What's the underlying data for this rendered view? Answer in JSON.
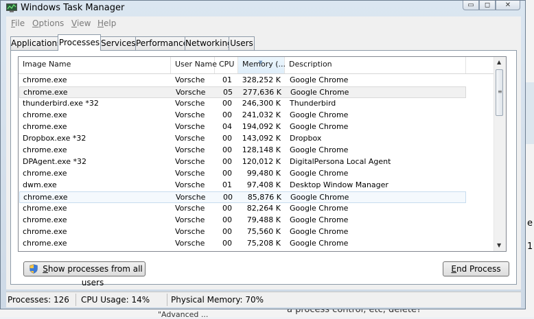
{
  "window": {
    "title": "Windows Task Manager"
  },
  "caption_buttons": {
    "min": "▭",
    "max": "◻",
    "close": "✕"
  },
  "menu": [
    {
      "key": "F",
      "rest": "ile"
    },
    {
      "key": "O",
      "rest": "ptions"
    },
    {
      "key": "V",
      "rest": "iew"
    },
    {
      "key": "H",
      "rest": "elp"
    }
  ],
  "tabs": [
    "Applications",
    "Processes",
    "Services",
    "Performance",
    "Networking",
    "Users"
  ],
  "active_tab": "Processes",
  "columns": {
    "name": "Image Name",
    "user": "User Name",
    "cpu": "CPU",
    "memory": "Memory (...",
    "description": "Description"
  },
  "processes": [
    {
      "name": "chrome.exe",
      "user": "Vorsche",
      "cpu": "01",
      "memory": "328,252 K",
      "description": "Google Chrome"
    },
    {
      "name": "chrome.exe",
      "user": "Vorsche",
      "cpu": "05",
      "memory": "277,636 K",
      "description": "Google Chrome"
    },
    {
      "name": "thunderbird.exe *32",
      "user": "Vorsche",
      "cpu": "00",
      "memory": "246,300 K",
      "description": "Thunderbird"
    },
    {
      "name": "chrome.exe",
      "user": "Vorsche",
      "cpu": "00",
      "memory": "241,032 K",
      "description": "Google Chrome"
    },
    {
      "name": "chrome.exe",
      "user": "Vorsche",
      "cpu": "04",
      "memory": "194,092 K",
      "description": "Google Chrome"
    },
    {
      "name": "Dropbox.exe *32",
      "user": "Vorsche",
      "cpu": "00",
      "memory": "143,092 K",
      "description": "Dropbox"
    },
    {
      "name": "chrome.exe",
      "user": "Vorsche",
      "cpu": "00",
      "memory": "128,148 K",
      "description": "Google Chrome"
    },
    {
      "name": "DPAgent.exe *32",
      "user": "Vorsche",
      "cpu": "00",
      "memory": "120,012 K",
      "description": "DigitalPersona Local Agent"
    },
    {
      "name": "chrome.exe",
      "user": "Vorsche",
      "cpu": "00",
      "memory": "99,480 K",
      "description": "Google Chrome"
    },
    {
      "name": "dwm.exe",
      "user": "Vorsche",
      "cpu": "01",
      "memory": "97,408 K",
      "description": "Desktop Window Manager"
    },
    {
      "name": "chrome.exe",
      "user": "Vorsche",
      "cpu": "00",
      "memory": "85,876 K",
      "description": "Google Chrome"
    },
    {
      "name": "chrome.exe",
      "user": "Vorsche",
      "cpu": "00",
      "memory": "82,264 K",
      "description": "Google Chrome"
    },
    {
      "name": "chrome.exe",
      "user": "Vorsche",
      "cpu": "00",
      "memory": "79,488 K",
      "description": "Google Chrome"
    },
    {
      "name": "chrome.exe",
      "user": "Vorsche",
      "cpu": "00",
      "memory": "75,560 K",
      "description": "Google Chrome"
    },
    {
      "name": "chrome.exe",
      "user": "Vorsche",
      "cpu": "00",
      "memory": "75,208 K",
      "description": "Google Chrome"
    }
  ],
  "buttons": {
    "show_all_key": "S",
    "show_all_rest": "how processes from all users",
    "end_key": "E",
    "end_rest": "nd Process"
  },
  "status": {
    "processes": "Processes: 126",
    "cpu_usage": "CPU Usage: 14%",
    "physical_memory": "Physical Memory: 70%"
  },
  "background": {
    "text_1": "e",
    "text_2": "1",
    "text_3": "\"Advanced ...",
    "text_4": "a process control, etc, delete?"
  },
  "colors": {
    "accent": "#3399ff",
    "selection": "#f4f9fd"
  },
  "icons": {
    "app": "task-manager-icon",
    "shield": "uac-shield-icon"
  }
}
